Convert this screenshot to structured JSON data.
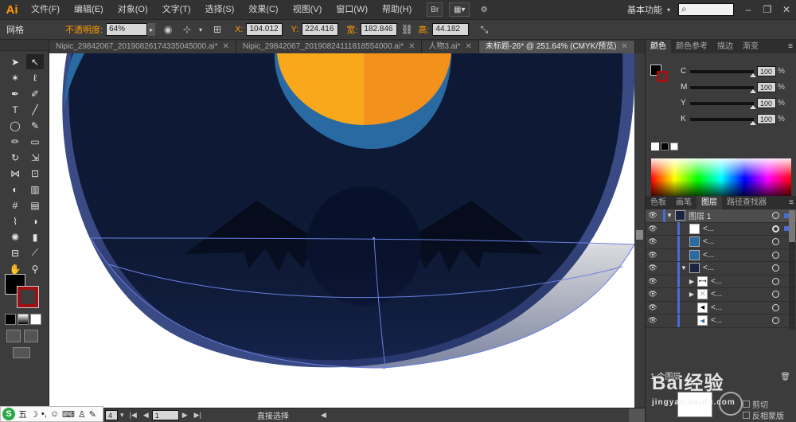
{
  "menubar": {
    "logo": "Ai",
    "items": [
      "文件(F)",
      "编辑(E)",
      "对象(O)",
      "文字(T)",
      "选择(S)",
      "效果(C)",
      "视图(V)",
      "窗口(W)",
      "帮助(H)"
    ],
    "workspace": "基本功能",
    "search_placeholder": ""
  },
  "controlbar": {
    "selection_label": "网格",
    "opacity_label": "不透明度:",
    "opacity_value": "64%",
    "x_label": "X:",
    "x_value": "104.012",
    "y_label": "Y:",
    "y_value": "224.416",
    "w_label": "宽:",
    "w_value": "182.846",
    "h_label": "高:",
    "h_value": "44.182"
  },
  "doctabs": [
    {
      "label": "Nipic_29842067_20190826174335045000.ai*",
      "active": false
    },
    {
      "label": "Nipic_29842067_20190824111818554000.ai*",
      "active": false
    },
    {
      "label": "人物3.ai*",
      "active": false
    },
    {
      "label": "未标题-26* @ 251.64% (CMYK/预览)",
      "active": true
    }
  ],
  "color_panel": {
    "tabs": [
      "颜色",
      "颜色参考",
      "描边",
      "渐变"
    ],
    "channels": [
      {
        "letter": "C",
        "value": "100"
      },
      {
        "letter": "M",
        "value": "100"
      },
      {
        "letter": "Y",
        "value": "100"
      },
      {
        "letter": "K",
        "value": "100"
      }
    ],
    "percent": "%"
  },
  "layers_panel": {
    "tabs": [
      "色板",
      "画笔",
      "图层",
      "路径查找器"
    ],
    "layer_name": "图层 1",
    "sublayers": [
      "<...",
      "<...",
      "<...",
      "<...",
      "<...",
      "<...",
      "<...",
      "<..."
    ],
    "footer_count": "1 个图层"
  },
  "lower_panel": {
    "clip_label": "剪切",
    "invert_label": "反相蒙版"
  },
  "statusbar": {
    "zoom": "4",
    "artboard": "1",
    "tool_name": "直接选择"
  },
  "ime": {
    "logo": "S",
    "label": "五"
  },
  "watermark": {
    "text": "Bai经验",
    "sub": "jingyan.baidu.com"
  },
  "colors": {
    "accent_orange": "#ff9a00",
    "canvas_night": "#0e1a35",
    "sun_yellow": "#f8a81a",
    "sun_orange": "#f2921c",
    "sun_ring": "#2a6aa3",
    "selection_blue": "#4b6cd6"
  }
}
